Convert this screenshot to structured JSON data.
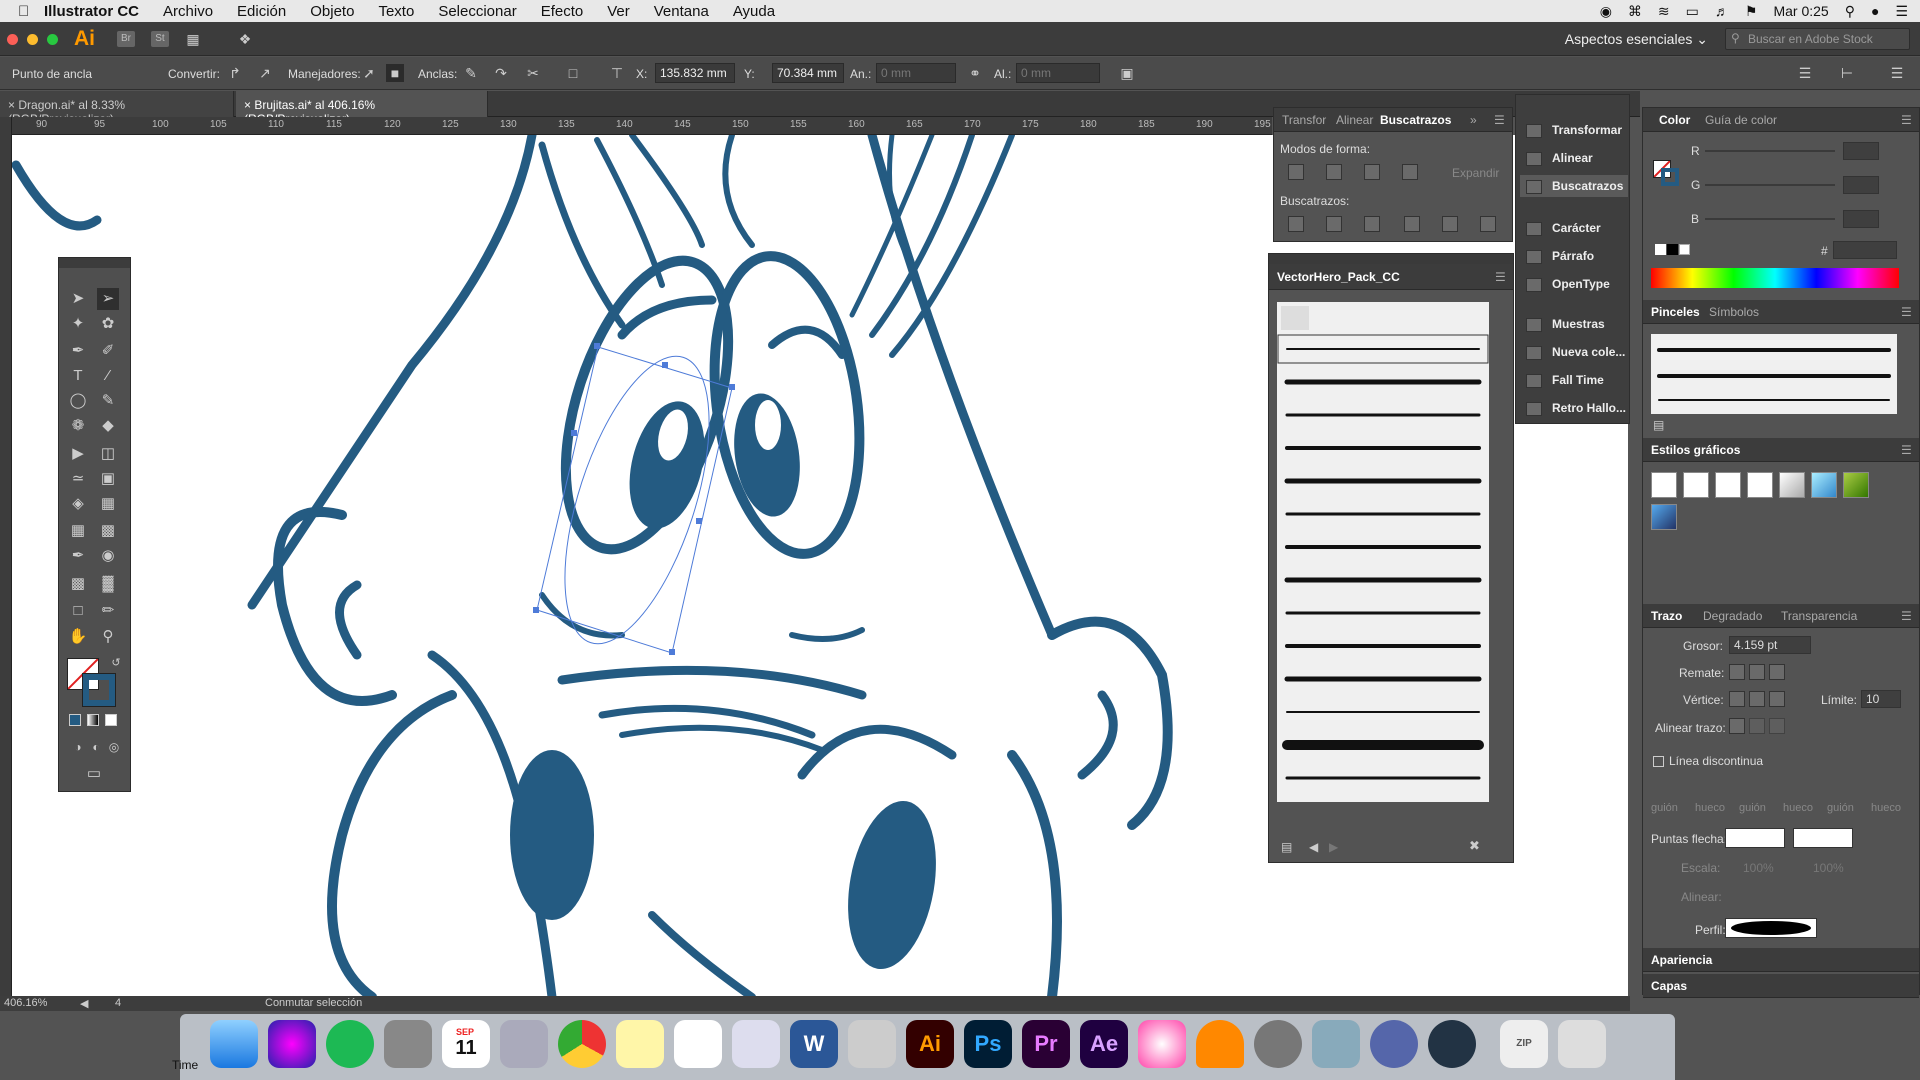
{
  "menubar": {
    "app": "Illustrator CC",
    "items": [
      "Archivo",
      "Edición",
      "Objeto",
      "Texto",
      "Seleccionar",
      "Efecto",
      "Ver",
      "Ventana",
      "Ayuda"
    ],
    "clock": "Mar 0:25"
  },
  "appbar": {
    "logo": "Ai",
    "badge_br": "Br",
    "badge_st": "St",
    "workspace": "Aspectos esenciales",
    "stock_placeholder": "Buscar en Adobe Stock"
  },
  "control": {
    "anchor_label": "Punto de ancla",
    "convert_label": "Convertir:",
    "handles_label": "Manejadores:",
    "anchors_label": "Anclas:",
    "x_label": "X:",
    "x_value": "135.832 mm",
    "y_label": "Y:",
    "y_value": "70.384 mm",
    "w_label": "An.:",
    "w_value": "0 mm",
    "h_label": "Al.:",
    "h_value": "0 mm"
  },
  "tabs": [
    {
      "label": "Dragon.ai* al 8.33% (RGB/Previsualizar)"
    },
    {
      "label": "Brujitas.ai* al 406.16% (RGB/Previsualizar)"
    }
  ],
  "ruler": [
    "90",
    "95",
    "100",
    "105",
    "110",
    "115",
    "120",
    "125",
    "130",
    "135",
    "140",
    "145",
    "150",
    "155",
    "160",
    "165",
    "170",
    "175",
    "180",
    "185",
    "190",
    "195"
  ],
  "status": {
    "zoom": "406.16%",
    "artboard": "4",
    "mode": "Conmutar selección"
  },
  "pathfinder": {
    "tabs": [
      "Transfor",
      "Alinear",
      "Buscatrazos"
    ],
    "shape_modes": "Modos de forma:",
    "expand": "Expandir",
    "pathfinders": "Buscatrazos:"
  },
  "dock_panel": {
    "items": [
      "Transformar",
      "Alinear",
      "Buscatrazos",
      "Carácter",
      "Párrafo",
      "OpenType",
      "Muestras",
      "Nueva cole...",
      "Fall Time",
      "Retro Hallo..."
    ]
  },
  "brushlib": {
    "title": "VectorHero_Pack_CC"
  },
  "color": {
    "tabs": [
      "Color",
      "Guía de color"
    ],
    "r": "R",
    "g": "G",
    "b": "B",
    "hash": "#"
  },
  "brushes": {
    "tabs": [
      "Pinceles",
      "Símbolos"
    ]
  },
  "graphic_styles": {
    "title": "Estilos gráficos"
  },
  "stroke": {
    "tabs": [
      "Trazo",
      "Degradado",
      "Transparencia"
    ],
    "weight_label": "Grosor:",
    "weight_value": "4.159 pt",
    "cap_label": "Remate:",
    "corner_label": "Vértice:",
    "limit_label": "Límite:",
    "limit_value": "10",
    "align_label": "Alinear trazo:",
    "dashed_label": "Línea discontinua",
    "dash_labels": [
      "guión",
      "hueco",
      "guión",
      "hueco",
      "guión",
      "hueco"
    ],
    "arrows_label": "Puntas flecha:",
    "scale_label": "Escala:",
    "scale_v1": "100%",
    "scale_v2": "100%",
    "align2_label": "Alinear:",
    "profile_label": "Perfil:"
  },
  "appearance": {
    "title": "Apariencia"
  },
  "layers": {
    "title": "Capas"
  },
  "colors": {
    "art": "#245b82",
    "ui_dark": "#3c3c3c",
    "ui_mid": "#535353",
    "accent": "#ff9a00"
  },
  "dock": {
    "apps": [
      "finder-icon",
      "siri-icon",
      "spotify-icon",
      "calculator-icon",
      "calendar-icon",
      "launchpad-icon",
      "chrome-icon",
      "notes-icon",
      "reminders-icon",
      "preview-icon",
      "word-icon",
      "photos-icon",
      "illustrator-icon",
      "photoshop-icon",
      "premiere-icon",
      "aftereffects-icon",
      "itunes-icon",
      "vlc-icon",
      "systemprefs-icon",
      "imagecapture-icon",
      "sound-icon",
      "quicktime-icon",
      "archive-icon",
      "trash-icon"
    ],
    "calendar_month": "SEP",
    "calendar_day": "11",
    "time_label": "Time",
    "ai": "Ai",
    "ps": "Ps",
    "pr": "Pr",
    "ae": "Ae",
    "w": "W",
    "zip": "ZIP"
  }
}
